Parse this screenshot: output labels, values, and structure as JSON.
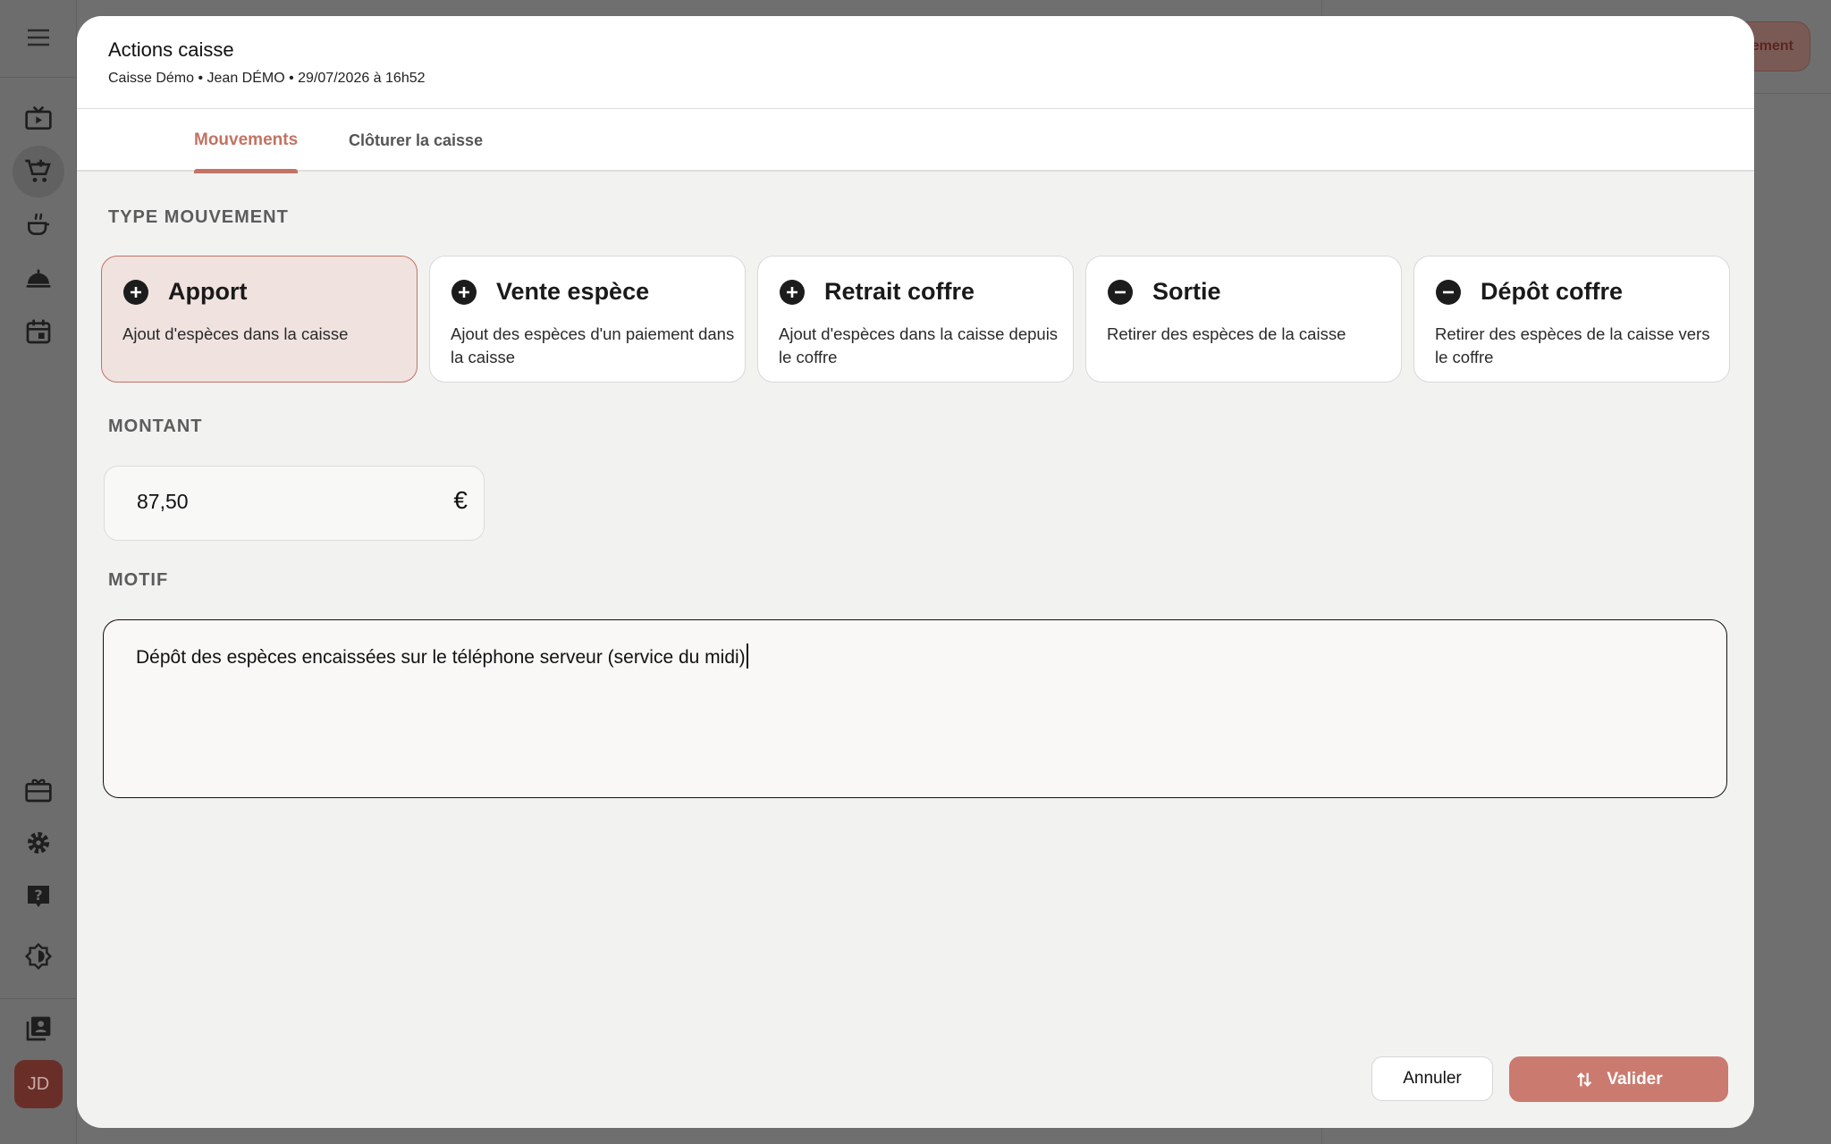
{
  "background": {
    "sidebar": {
      "items": [
        {
          "icon": "menu-icon"
        },
        {
          "icon": "tv-play-icon"
        },
        {
          "icon": "cart-plus-icon",
          "active": true
        },
        {
          "icon": "kitchen-pot-icon"
        },
        {
          "icon": "service-cloche-icon"
        },
        {
          "icon": "calendar-icon"
        },
        {
          "icon": "gift-card-icon"
        },
        {
          "icon": "gear-icon"
        },
        {
          "icon": "help-icon"
        },
        {
          "icon": "brightness-icon"
        },
        {
          "icon": "account-book-icon"
        }
      ],
      "avatar_initials": "JD"
    },
    "right_pill_label": "ement"
  },
  "modal": {
    "title": "Actions caisse",
    "subtitle": "Caisse Démo • Jean DÉMO • 29/07/2026 à 16h52",
    "tabs": [
      {
        "label": "Mouvements",
        "active": true
      },
      {
        "label": "Clôturer la caisse",
        "active": false
      }
    ],
    "type_section_label": "TYPE MOUVEMENT",
    "movement_types": [
      {
        "title": "Apport",
        "description": "Ajout d'espèces dans la caisse",
        "icon": "plus-circle-icon",
        "selected": true
      },
      {
        "title": "Vente espèce",
        "description": "Ajout des espèces d'un paiement dans la caisse",
        "icon": "plus-circle-icon",
        "selected": false
      },
      {
        "title": "Retrait coffre",
        "description": "Ajout d'espèces dans la caisse depuis le coffre",
        "icon": "plus-circle-icon",
        "selected": false
      },
      {
        "title": "Sortie",
        "description": "Retirer des espèces de la caisse",
        "icon": "minus-circle-icon",
        "selected": false
      },
      {
        "title": "Dépôt coffre",
        "description": "Retirer des espèces de la caisse vers le coffre",
        "icon": "minus-circle-icon",
        "selected": false
      }
    ],
    "amount_section_label": "MONTANT",
    "amount_value": "87,50",
    "amount_currency": "€",
    "motif_section_label": "MOTIF",
    "motif_value": "Dépôt des espèces encaissées sur le téléphone serveur (service du midi)",
    "cancel_label": "Annuler",
    "validate_label": "Valider",
    "colors": {
      "accent": "#c27364",
      "button": "#cb7a6f",
      "selected_card": "#efe2df"
    }
  }
}
